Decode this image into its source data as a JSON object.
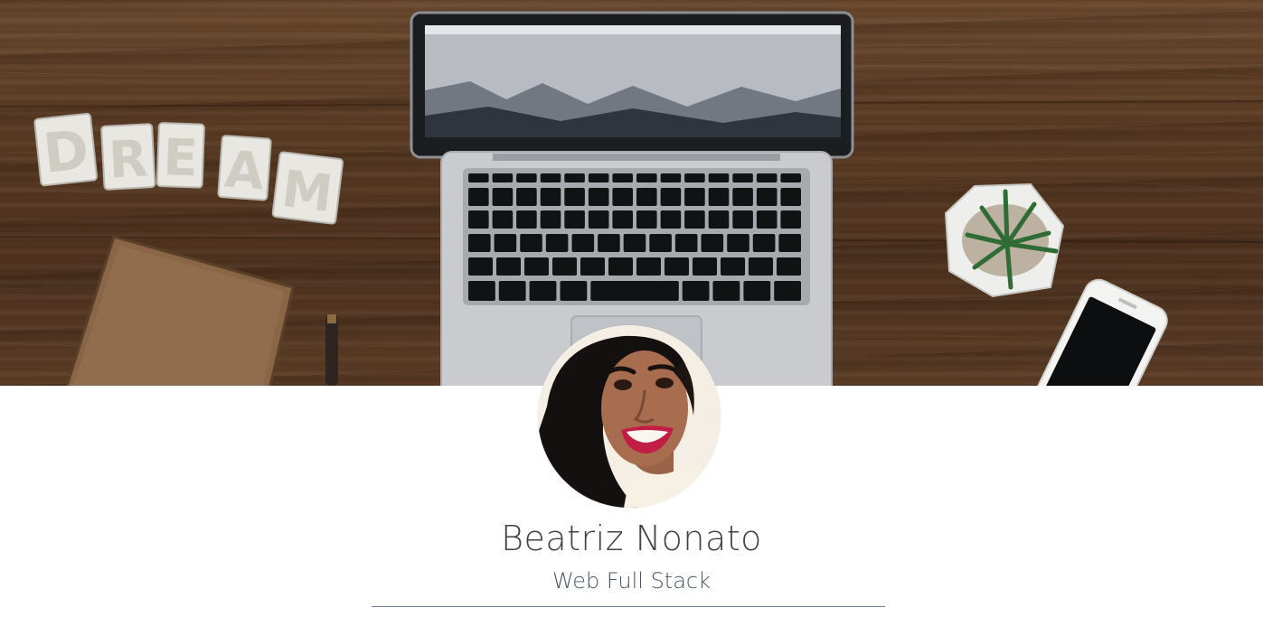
{
  "cover": {
    "decor_word": "DREAM"
  },
  "profile": {
    "name": "Beatriz Nonato",
    "role": "Web Full Stack"
  },
  "colors": {
    "name_text": "#3d4148",
    "role_text": "#4a5568",
    "divider": "#6f7f95",
    "wood": "#5a3b24"
  },
  "icons": [
    "cover-photo",
    "profile-avatar"
  ]
}
